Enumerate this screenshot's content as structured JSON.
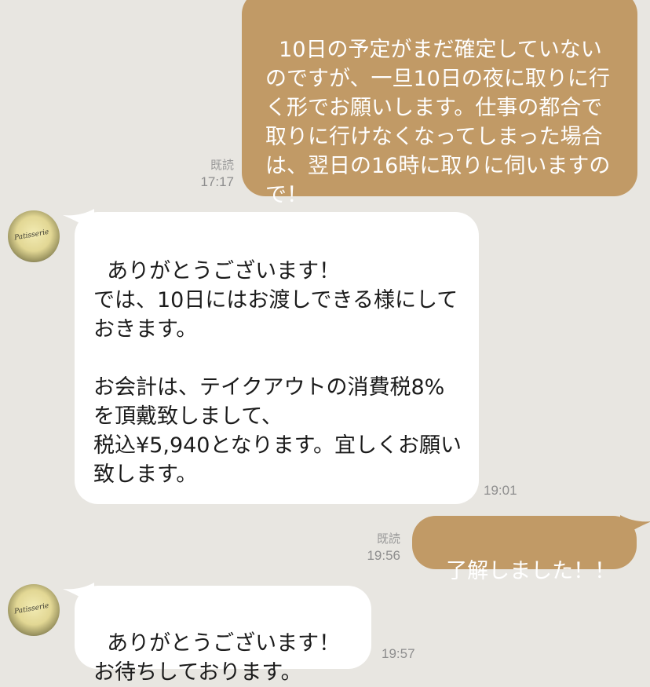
{
  "messages": [
    {
      "id": "m1",
      "direction": "outgoing",
      "text": "10日の予定がまだ確定していないのですが、一旦10日の夜に取りに行く形でお願いします。仕事の都合で取りに行けなくなってしまった場合は、翌日の16時に取りに伺いますので！",
      "read_label": "既読",
      "time": "17:17"
    },
    {
      "id": "m2",
      "direction": "incoming",
      "text": "ありがとうございます！\nでは、10日にはお渡しできる様にしておきます。\n\nお会計は、テイクアウトの消費税8%を頂戴致しまして、\n税込¥5,940となります。宜しくお願い致します。",
      "time": "19:01"
    },
    {
      "id": "m3",
      "direction": "outgoing",
      "text": "了解しました！！",
      "read_label": "既読",
      "time": "19:56"
    },
    {
      "id": "m4",
      "direction": "incoming",
      "text": "ありがとうございます！\nお待ちしております。",
      "time": "19:57"
    }
  ],
  "avatar": {
    "label": "Patisserie"
  },
  "colors": {
    "outgoing_bubble": "#c19a66",
    "incoming_bubble": "#ffffff",
    "background": "#e8e6e1"
  }
}
